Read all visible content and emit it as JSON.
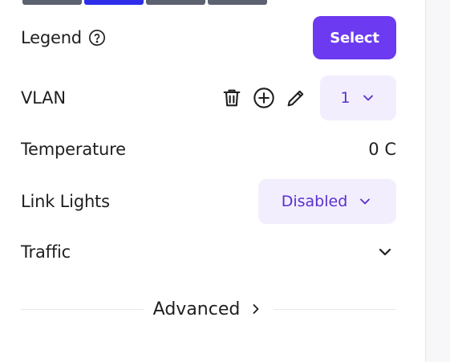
{
  "legend": {
    "label": "Legend",
    "button": "Select"
  },
  "vlan": {
    "label": "VLAN",
    "value": "1"
  },
  "temperature": {
    "label": "Temperature",
    "value": "0 C"
  },
  "link_lights": {
    "label": "Link Lights",
    "value": "Disabled"
  },
  "traffic": {
    "label": "Traffic"
  },
  "advanced": {
    "label": "Advanced"
  },
  "colors": {
    "accent": "#6c3af0",
    "dropdown_bg": "#f2eefd",
    "dropdown_text": "#5a2fd0"
  }
}
